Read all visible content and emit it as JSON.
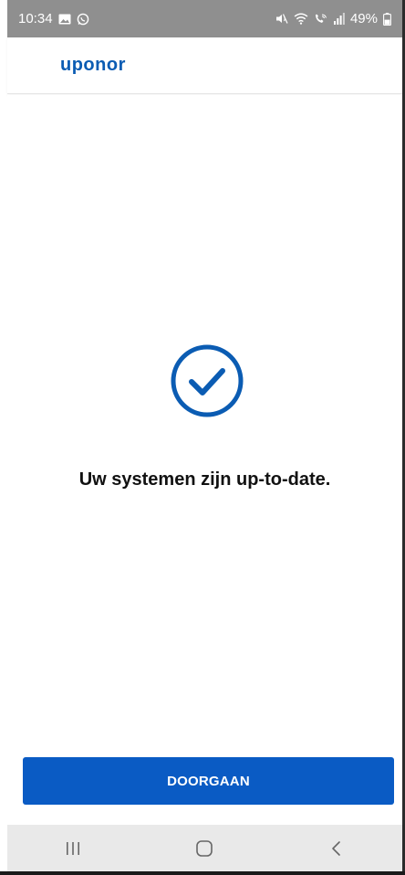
{
  "status_bar": {
    "time": "10:34",
    "battery": "49%",
    "left_icons": [
      "gallery-icon",
      "whatsapp-icon"
    ],
    "right_icons": [
      "mute-icon",
      "wifi-icon",
      "wifi-calling-icon",
      "signal-icon",
      "battery-icon"
    ]
  },
  "header": {
    "logo_text": "uponor"
  },
  "main": {
    "status_icon": "check-circle-icon",
    "message": "Uw systemen zijn up-to-date."
  },
  "actions": {
    "continue_label": "DOORGAAN"
  },
  "navigation": {
    "items": [
      "recent-apps-icon",
      "home-icon",
      "back-icon"
    ]
  },
  "colors": {
    "brand": "#0b5cb3",
    "button": "#0a5bc4",
    "status_bar": "#8f8f8f",
    "nav_bar": "#e9e9e9"
  }
}
